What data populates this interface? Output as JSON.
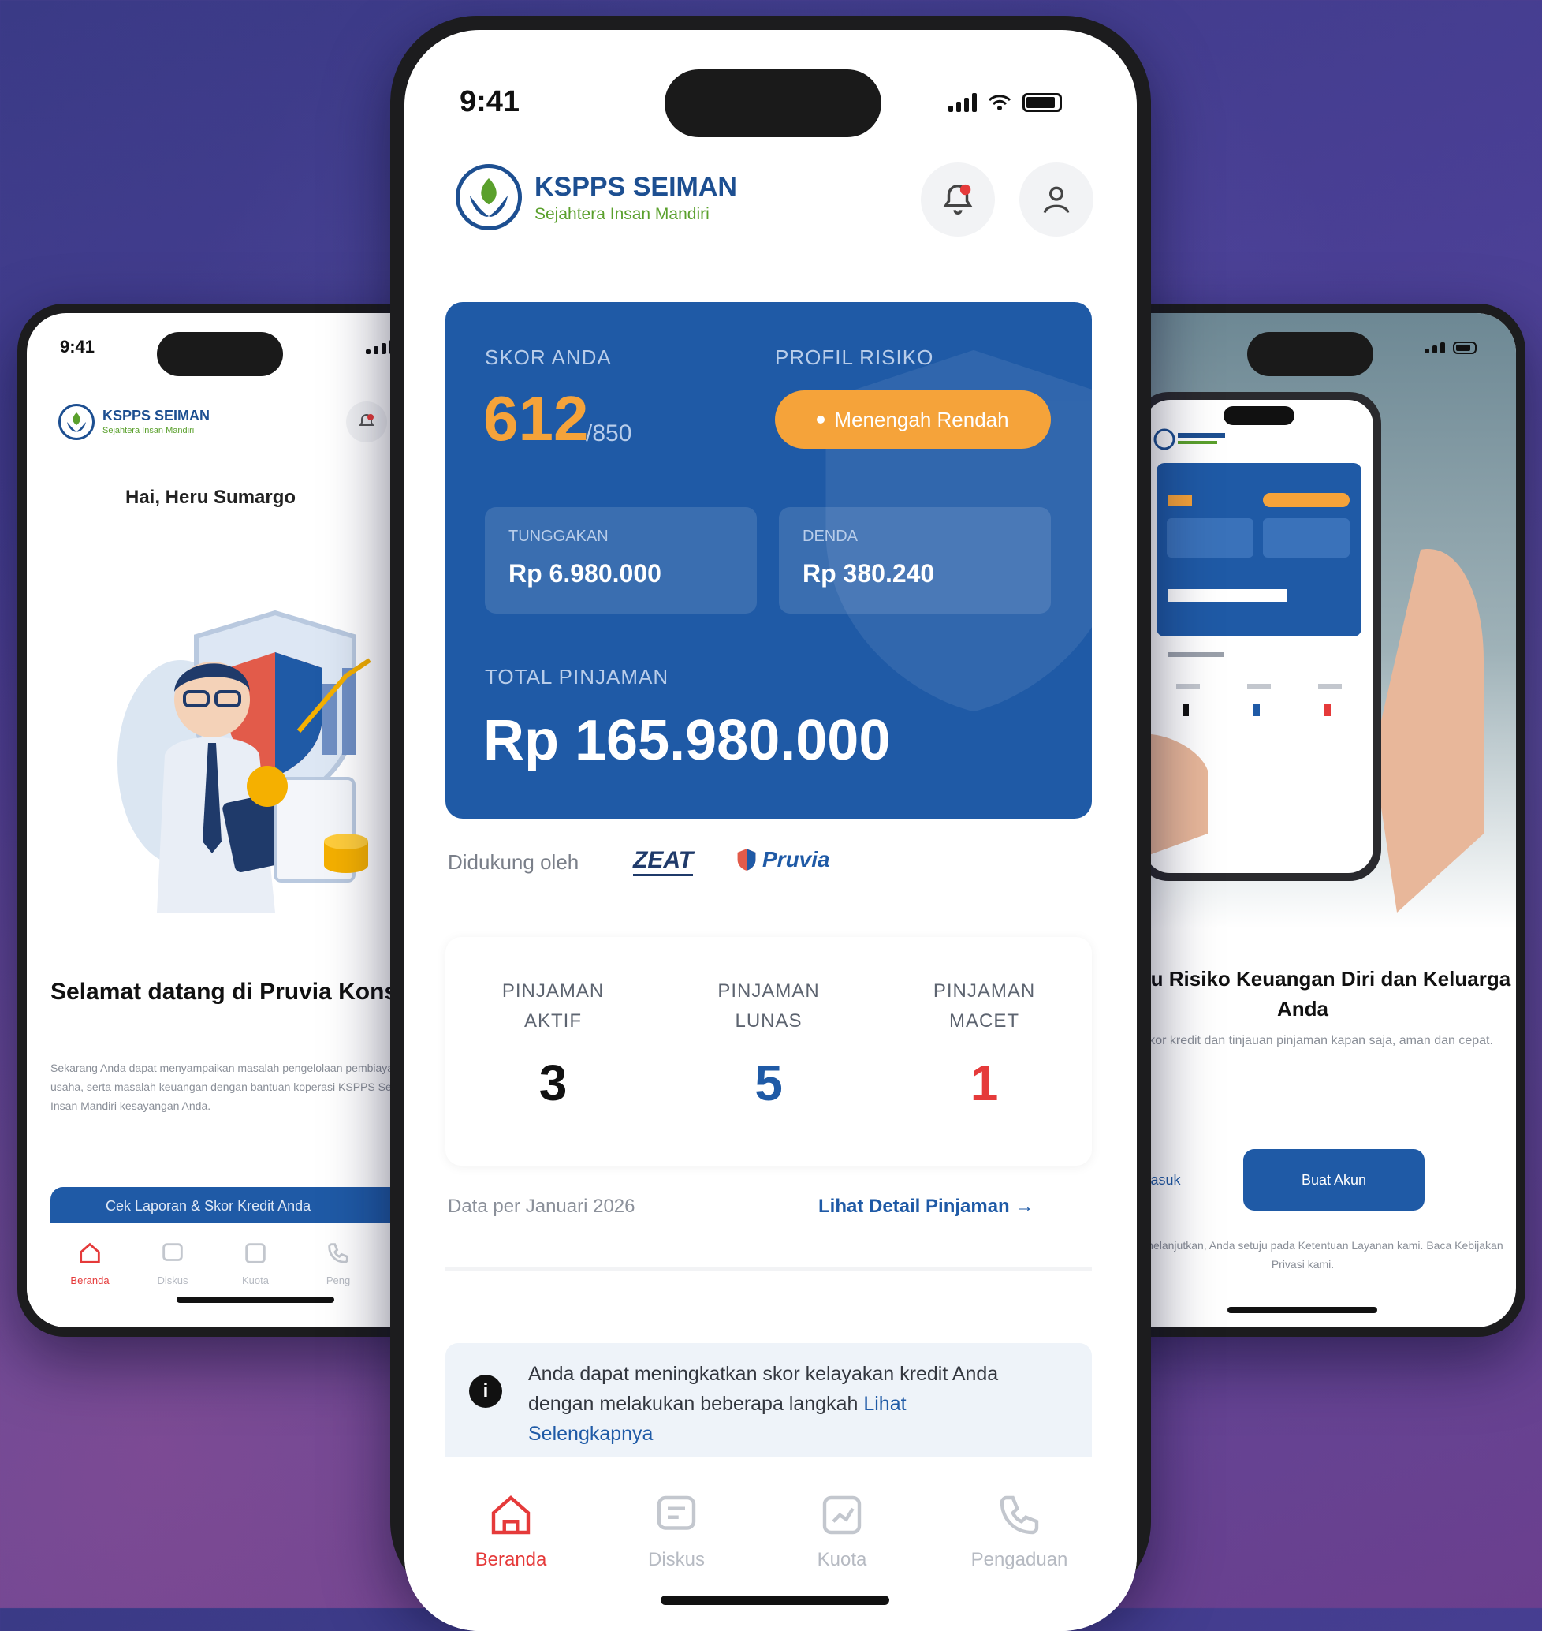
{
  "center": {
    "status_time": "9:41",
    "brand_name": "KSPPS SEIMAN",
    "brand_tagline": "Sejahtera Insan Mandiri",
    "score_label": "SKOR ANDA",
    "score_value": "612",
    "score_max": "/850",
    "risk_label": "PROFIL RISIKO",
    "risk_value": "Menengah Rendah",
    "box1_label": "TUNGGAKAN",
    "box1_value": "Rp 6.980.000",
    "box2_label": "DENDA",
    "box2_value": "Rp 380.240",
    "total_label": "TOTAL PINJAMAN",
    "total_value": "Rp 165.980.000",
    "supported_by": "Didukung oleh",
    "partners": [
      "ZEAT",
      "Pruvia"
    ],
    "loans": [
      {
        "line1": "PINJAMAN",
        "line2": "AKTIF",
        "count": "3",
        "color": "#111111"
      },
      {
        "line1": "PINJAMAN",
        "line2": "LUNAS",
        "count": "5",
        "color": "#1f5aa6"
      },
      {
        "line1": "PINJAMAN",
        "line2": "MACET",
        "count": "1",
        "color": "#e53a3a"
      }
    ],
    "data_date": "Data per Januari 2026",
    "detail_link": "Lihat Detail Pinjaman →",
    "tip_text": "Anda dapat meningkatkan skor kelayakan kredit Anda dengan melakukan beberapa langkah",
    "tip_link": "Lihat Selengkapnya",
    "nav": [
      "Beranda",
      "Diskus",
      "Kuota",
      "Pengaduan"
    ]
  },
  "left": {
    "status_time": "9:41",
    "brand_name": "KSPPS SEIMAN",
    "brand_tagline": "Sejahtera Insan Mandiri",
    "greeting": "Hai, Heru Sumargo",
    "title": "Selamat datang di Pruvia Konsul.",
    "paragraph": "Sekarang Anda dapat menyampaikan masalah pengelolaan pembiayaan, usaha, serta masalah keuangan dengan bantuan koperasi KSPPS Sejahtera Insan Mandiri kesayangan Anda.",
    "button": "Cek Laporan & Skor Kredit Anda",
    "nav": [
      "Beranda",
      "Diskus",
      "Kuota",
      "Peng"
    ]
  },
  "right": {
    "title": "Pantau Risiko Keuangan Diri dan Keluarga Anda",
    "paragraph": "Lihat skor kredit dan tinjauan pinjaman kapan saja, aman dan cepat.",
    "ghost_button": "Masuk",
    "primary_button": "Buat Akun",
    "footer": "Dengan melanjutkan, Anda setuju pada Ketentuan Layanan kami. Baca Kebijakan Privasi kami."
  },
  "colors": {
    "brand_blue": "#1f5aa6",
    "accent_orange": "#f5a33a",
    "danger_red": "#e53a3a",
    "brand_green": "#5aa02c"
  }
}
